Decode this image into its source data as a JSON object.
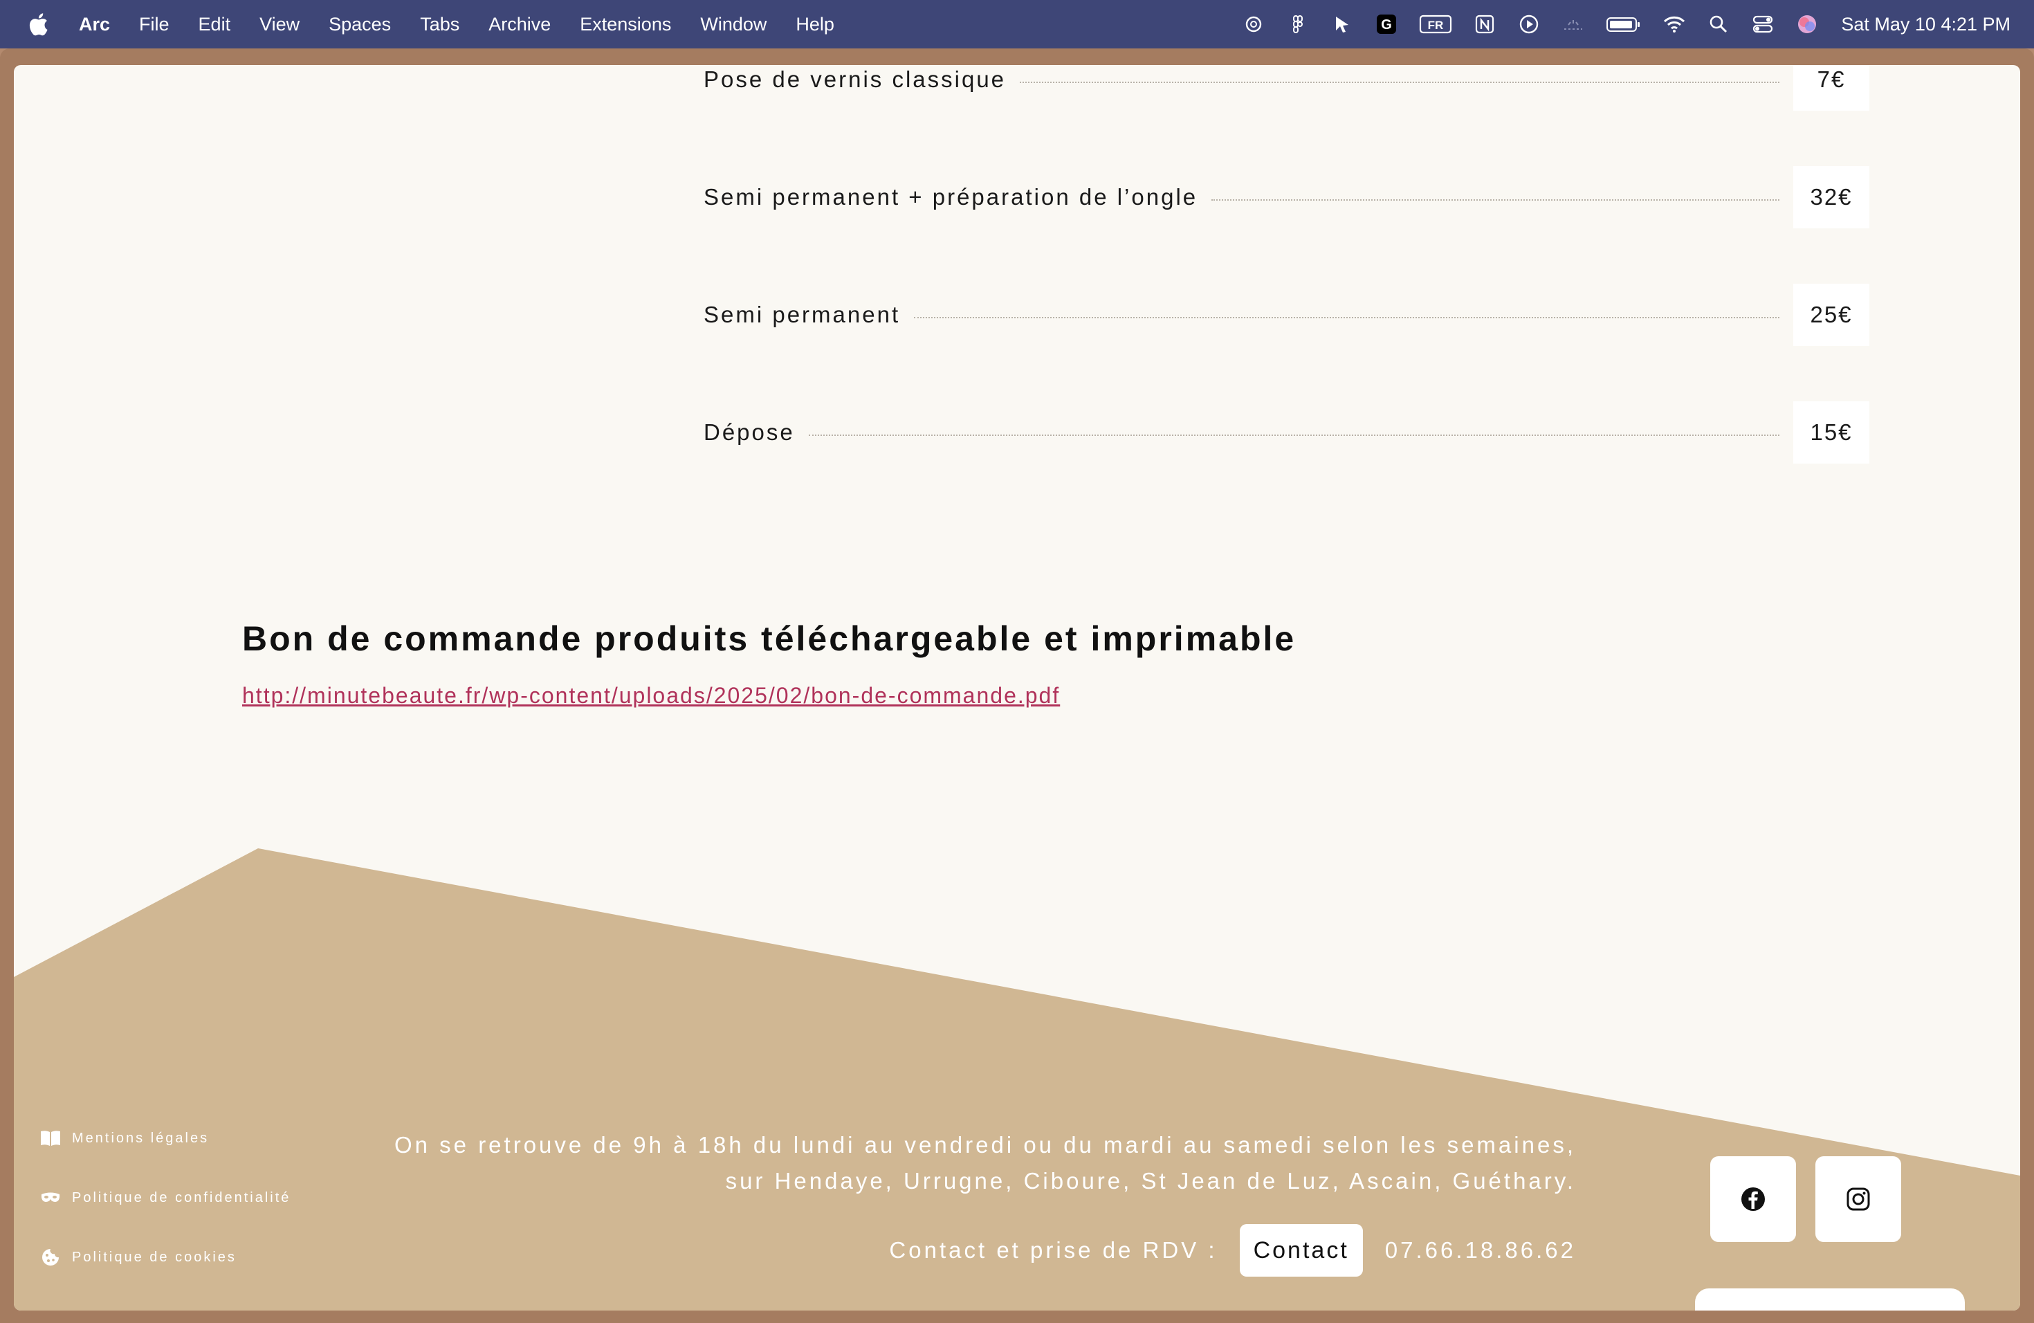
{
  "menubar": {
    "app_name": "Arc",
    "items": [
      "File",
      "Edit",
      "View",
      "Spaces",
      "Tabs",
      "Archive",
      "Extensions",
      "Window",
      "Help"
    ],
    "status_icons": [
      "openai-icon",
      "figma-icon",
      "cursor-tool-icon",
      "grammarly-icon",
      "input-source-fr-icon",
      "notion-icon",
      "play-circle-icon",
      "dimmed-status-icon",
      "battery-icon",
      "wifi-icon",
      "spotlight-search-icon",
      "control-center-icon",
      "siri-icon"
    ],
    "input_source": "FR",
    "clock": "Sat May 10  4:21 PM"
  },
  "prices": [
    {
      "name": "Pose de vernis classique",
      "price": "7€"
    },
    {
      "name": "Semi permanent + préparation de l’ongle",
      "price": "32€"
    },
    {
      "name": "Semi permanent",
      "price": "25€"
    },
    {
      "name": "Dépose",
      "price": "15€"
    }
  ],
  "order": {
    "title": "Bon de commande produits téléchargeable et imprimable",
    "link": "http://minutebeaute.fr/wp-content/uploads/2025/02/bon-de-commande.pdf"
  },
  "footer": {
    "legal": [
      {
        "label": "Mentions légales",
        "icon": "book-icon"
      },
      {
        "label": "Politique de confidentialité",
        "icon": "mask-icon"
      },
      {
        "label": "Politique de cookies",
        "icon": "cookie-icon"
      }
    ],
    "hours_line1": "On se retrouve de 9h à 18h du lundi au vendredi ou du mardi au samedi selon les semaines,",
    "hours_line2": "sur Hendaye, Urrugne, Ciboure, St Jean de Luz, Ascain, Guéthary.",
    "contact_label": "Contact et prise de RDV :",
    "contact_button": "Contact",
    "phone": "07.66.18.86.62",
    "social": [
      "facebook-icon",
      "instagram-icon"
    ]
  },
  "colors": {
    "menubar": "#3e4677",
    "page_bg": "#faf8f3",
    "footer_bg": "#d0b793",
    "link": "#b0325a",
    "frame": "#a57c60"
  }
}
